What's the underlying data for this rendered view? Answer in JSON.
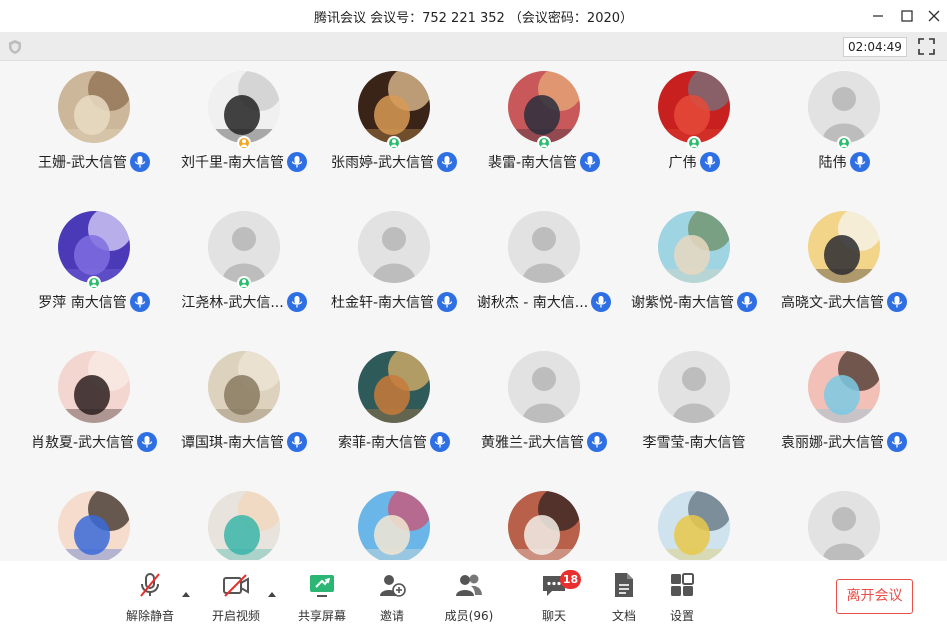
{
  "window": {
    "title": "腾讯会议 会议号：752 221 352 （会议密码：2020）",
    "timer": "02:04:49"
  },
  "participants": [
    {
      "name": "王姗-武大信管",
      "avatar": "photo-hamster"
    },
    {
      "name": "刘千里-南大信管",
      "avatar": "photo-panda",
      "badge": "orange"
    },
    {
      "name": "张雨婷-武大信管",
      "avatar": "photo-woman-candle",
      "badge": "green"
    },
    {
      "name": "裴雷-南大信管",
      "avatar": "photo-sunset-trees",
      "badge": "green"
    },
    {
      "name": "广伟",
      "avatar": "photo-red-tree",
      "badge": "green"
    },
    {
      "name": "陆伟",
      "avatar": "default",
      "badge": "green"
    },
    {
      "name": "罗萍  南大信管",
      "avatar": "photo-purple-text",
      "badge": "green"
    },
    {
      "name": "江尧林-武大信...",
      "avatar": "default",
      "badge": "green"
    },
    {
      "name": "杜金轩-南大信管",
      "avatar": "default"
    },
    {
      "name": "谢秋杰 - 南大信...",
      "avatar": "default"
    },
    {
      "name": "谢紫悦-南大信管",
      "avatar": "photo-toy-cat"
    },
    {
      "name": "高晓文-武大信管",
      "avatar": "photo-anime-mask"
    },
    {
      "name": "肖敖夏-武大信管",
      "avatar": "photo-girl-portrait"
    },
    {
      "name": "谭国琪-南大信管",
      "avatar": "photo-sketch"
    },
    {
      "name": "索菲-南大信管",
      "avatar": "photo-cartoon-mouse"
    },
    {
      "name": "黄雅兰-武大信管",
      "avatar": "default"
    },
    {
      "name": "李雪莹-南大信管",
      "avatar": "default",
      "nomic": true
    },
    {
      "name": "袁丽娜-武大信管",
      "avatar": "photo-n95-mask"
    },
    {
      "name": "",
      "avatar": "photo-crying-child"
    },
    {
      "name": "",
      "avatar": "photo-cat-mask"
    },
    {
      "name": "",
      "avatar": "photo-beach-person"
    },
    {
      "name": "",
      "avatar": "photo-woman-brick"
    },
    {
      "name": "",
      "avatar": "photo-girl-outdoor"
    },
    {
      "name": "",
      "avatar": "default"
    }
  ],
  "toolbar": {
    "unmute": "解除静音",
    "start_video": "开启视频",
    "share_screen": "共享屏幕",
    "invite": "邀请",
    "members": "成员(96)",
    "chat": "聊天",
    "chat_badge": "18",
    "docs": "文档",
    "settings": "设置",
    "leave": "离开会议"
  },
  "colors": {
    "accent": "#2f6fe4",
    "host_badge": "#2bbd6b",
    "cohost_badge": "#f5a623",
    "leave": "#e8504b",
    "share_green": "#2bb673"
  }
}
